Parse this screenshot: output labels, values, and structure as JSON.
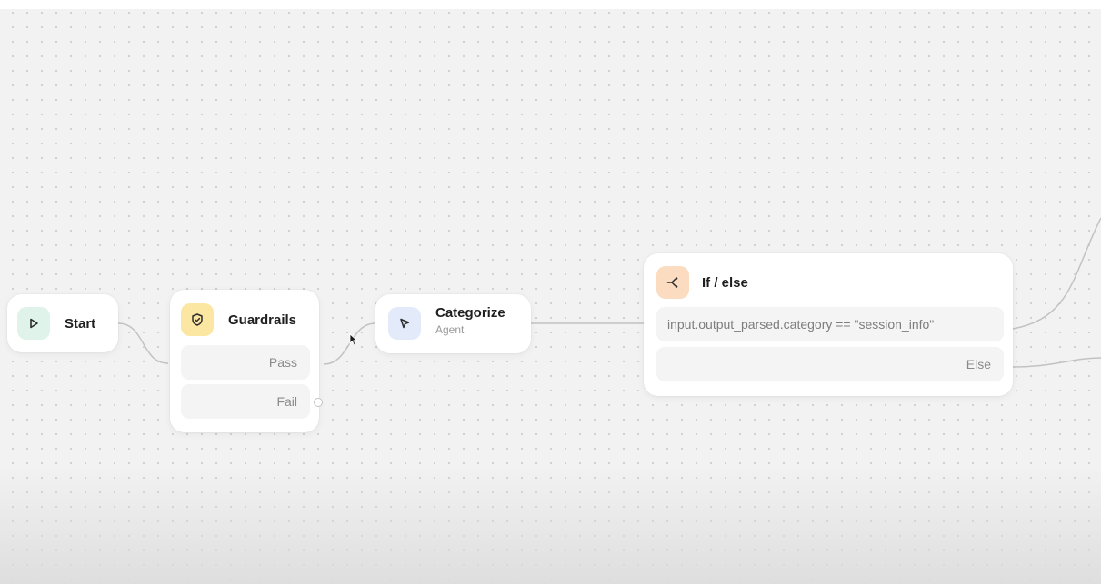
{
  "canvas": {
    "accent_colors": {
      "start": "#dff3ea",
      "guardrails": "#fbe7a1",
      "agent": "#e3ebfb",
      "ifelse": "#fbdcc0",
      "edge": "#bdbdbd"
    }
  },
  "nodes": {
    "start": {
      "title": "Start",
      "icon": "play-icon"
    },
    "guardrails": {
      "title": "Guardrails",
      "icon": "shield-check-icon",
      "branches": [
        "Pass",
        "Fail"
      ]
    },
    "categorize": {
      "title": "Categorize",
      "subtitle": "Agent",
      "icon": "cursor-arrow-icon"
    },
    "ifelse": {
      "title": "If / else",
      "icon": "branch-split-icon",
      "condition": "input.output_parsed.category == \"session_info\"",
      "else_label": "Else"
    }
  }
}
